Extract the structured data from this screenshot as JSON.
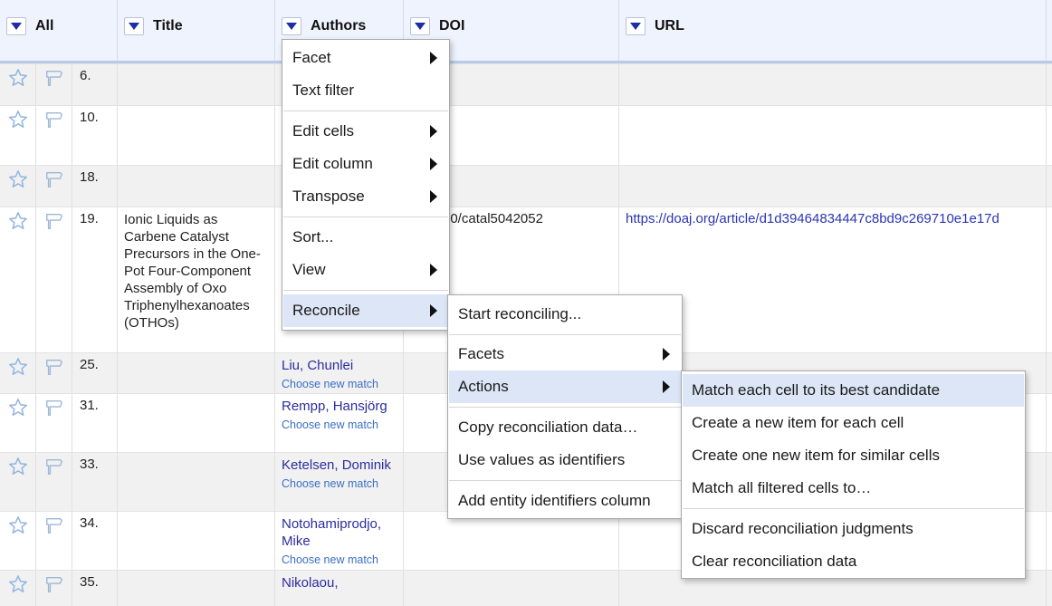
{
  "columns": {
    "all": "All",
    "title": "Title",
    "authors": "Authors",
    "doi": "DOI",
    "url": "URL"
  },
  "rows": [
    {
      "num": "6.",
      "title": "",
      "author": "",
      "choose": "",
      "doi": "",
      "url": ""
    },
    {
      "num": "10.",
      "title": "",
      "author": "",
      "choose": "",
      "doi": "",
      "url": ""
    },
    {
      "num": "18.",
      "title": "",
      "author": "",
      "choose": "",
      "doi": "",
      "url": ""
    },
    {
      "num": "19.",
      "title": "Ionic Liquids as Carbene Catalyst Precursors in the One-Pot Four-Component Assembly of Oxo Triphenylhexanoates (OTHOs)",
      "author": "",
      "choose": "",
      "doi": "90/catal5042052",
      "url": "https://doaj.org/article/d1d39464834447c8bd9c269710e1e17d"
    },
    {
      "num": "25.",
      "title": "",
      "author": "Liu, Chunlei",
      "choose": "Choose new match",
      "doi": "",
      "url": ""
    },
    {
      "num": "31.",
      "title": "",
      "author": "Rempp, Hansjörg",
      "choose": "Choose new match",
      "doi": "",
      "url": ""
    },
    {
      "num": "33.",
      "title": "",
      "author": "Ketelsen, Dominik",
      "choose": "Choose new match",
      "doi": "",
      "url": ""
    },
    {
      "num": "34.",
      "title": "",
      "author": "Notohamiprodjo, Mike",
      "choose": "Choose new match",
      "doi": "",
      "url": ""
    },
    {
      "num": "35.",
      "title": "",
      "author": "Nikolaou,",
      "choose": "",
      "doi": "",
      "url": ""
    }
  ],
  "column_menu": {
    "items": [
      "Facet",
      "Text filter",
      "Edit cells",
      "Edit column",
      "Transpose",
      "Sort...",
      "View",
      "Reconcile"
    ]
  },
  "reconcile_menu": {
    "items": [
      "Start reconciling...",
      "Facets",
      "Actions",
      "Copy reconciliation data…",
      "Use values as identifiers",
      "Add entity identifiers column"
    ]
  },
  "actions_menu": {
    "items": [
      "Match each cell to its best candidate",
      "Create a new item for each cell",
      "Create one new item for similar cells",
      "Match all filtered cells to…",
      "Discard reconciliation judgments",
      "Clear reconciliation data"
    ]
  },
  "icons": {
    "column_dropdown": "triangle-down-icon",
    "star": "star-icon",
    "flag": "flag-icon",
    "submenu": "chevron-right-icon"
  },
  "colors": {
    "header_bg": "#eef3fd",
    "menu_highlight": "#dce6f6",
    "link": "#2c2ca0"
  }
}
